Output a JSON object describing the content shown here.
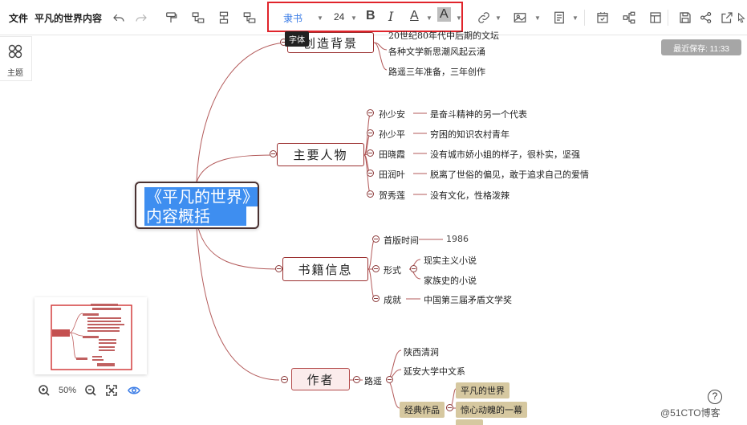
{
  "toolbar": {
    "file_menu": "文件",
    "doc_title": "平凡的世界内容",
    "font_name": "隶书",
    "font_size": "24",
    "bold_glyph": "B",
    "italic_glyph": "I",
    "color_glyph": "A",
    "highlight_glyph": "A",
    "tooltip": "字体",
    "highlight_color": "#e0242b"
  },
  "sidebar": {
    "theme_label": "主题"
  },
  "save_status": "最近保存: 11:33",
  "map": {
    "root": {
      "line1": "《平凡的世界》",
      "line2": "内容概括"
    },
    "branches": {
      "background": {
        "label": "创造背景",
        "cut_text": "20世纪80年代中后期的文坛",
        "items": [
          "各种文学新思潮风起云涌",
          "路遥三年准备，三年创作"
        ]
      },
      "characters": {
        "label": "主要人物",
        "items": [
          {
            "name": "孙少安",
            "desc": "是奋斗精神的另一个代表"
          },
          {
            "name": "孙少平",
            "desc": "穷困的知识农村青年"
          },
          {
            "name": "田晓霞",
            "desc": "没有城市娇小姐的样子，很朴实，坚强"
          },
          {
            "name": "田润叶",
            "desc": "脱离了世俗的偏见，敢于追求自己的爱情"
          },
          {
            "name": "贺秀莲",
            "desc": "没有文化，性格泼辣"
          }
        ]
      },
      "book": {
        "label": "书籍信息",
        "first_pub_label": "首版时间",
        "first_pub_value": "1986",
        "form_label": "形式",
        "forms": [
          "现实主义小说",
          "家族史的小说"
        ],
        "award_label": "成就",
        "award_value": "中国第三届矛盾文学奖"
      },
      "author": {
        "label": "作者",
        "name": "路遥",
        "items": [
          "陕西清涧",
          "延安大学中文系"
        ],
        "works_label": "经典作品",
        "works": [
          "平凡的世界",
          "惊心动魄的一幕"
        ]
      }
    }
  },
  "zoom": {
    "level": "50%"
  },
  "help_glyph": "?",
  "watermark": "@51CTO博客"
}
